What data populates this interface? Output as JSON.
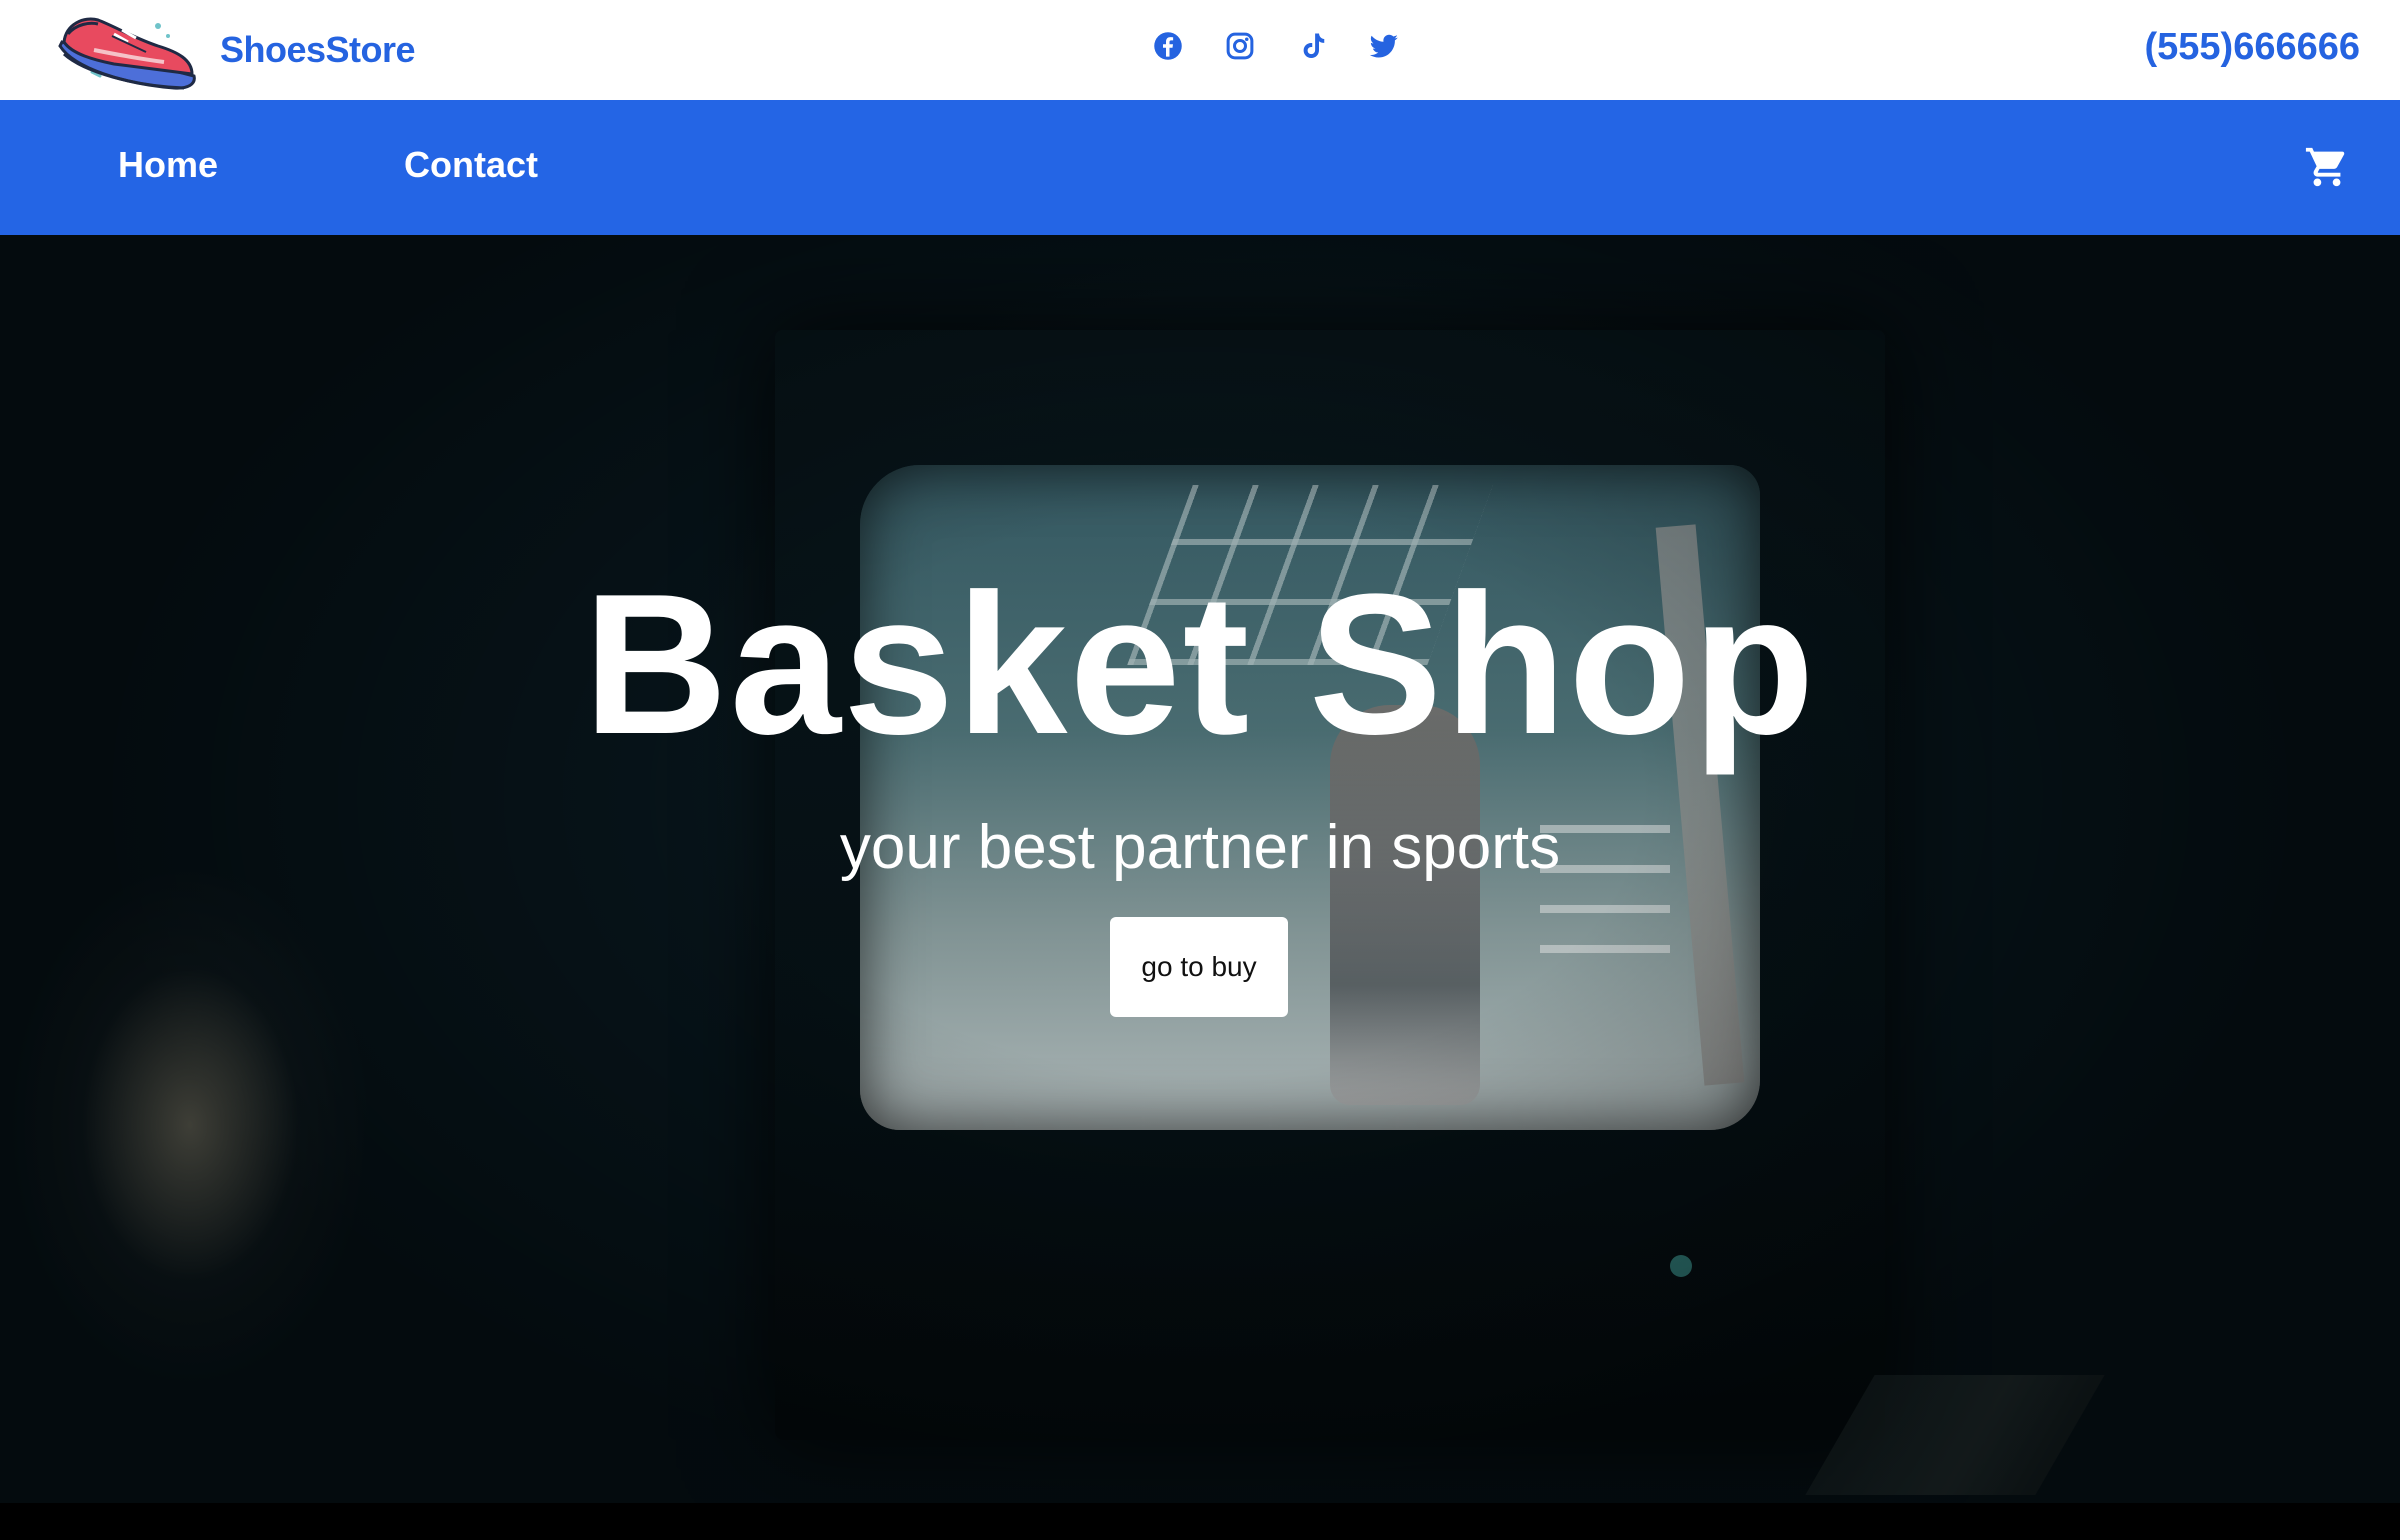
{
  "header": {
    "brand_name": "ShoesStore",
    "logo_icon": "sneaker-logo-icon",
    "socials": [
      {
        "name": "facebook-icon"
      },
      {
        "name": "instagram-icon"
      },
      {
        "name": "tiktok-icon"
      },
      {
        "name": "twitter-icon"
      }
    ],
    "phone": "(555)666666",
    "accent_color": "#2563e0"
  },
  "nav": {
    "items": [
      {
        "label": "Home"
      },
      {
        "label": "Contact"
      }
    ],
    "cart_icon": "cart-icon",
    "background_color": "#2465e5"
  },
  "hero": {
    "title": "Basket Shop",
    "subtitle": "your best partner in sports",
    "button_label": "go to buy"
  }
}
